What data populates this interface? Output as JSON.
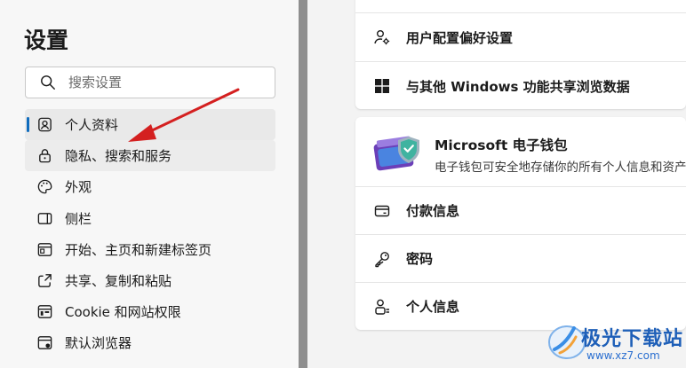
{
  "sidebar": {
    "title": "设置",
    "search": {
      "placeholder": "搜索设置"
    },
    "items": [
      {
        "label": "个人资料",
        "icon": "profile-icon"
      },
      {
        "label": "隐私、搜索和服务",
        "icon": "lock-icon"
      },
      {
        "label": "外观",
        "icon": "palette-icon"
      },
      {
        "label": "侧栏",
        "icon": "sidebar-icon"
      },
      {
        "label": "开始、主页和新建标签页",
        "icon": "home-icon"
      },
      {
        "label": "共享、复制和粘贴",
        "icon": "share-icon"
      },
      {
        "label": "Cookie 和网站权限",
        "icon": "site-permissions-icon"
      },
      {
        "label": "默认浏览器",
        "icon": "browser-icon"
      }
    ],
    "active_index": 0
  },
  "main": {
    "profile_card": {
      "rows": [
        {
          "label": "用户配置偏好设置",
          "icon": "user-settings-icon"
        },
        {
          "label": "与其他 Windows 功能共享浏览数据",
          "icon": "windows-icon"
        }
      ]
    },
    "wallet_card": {
      "title": "Microsoft 电子钱包",
      "description": "电子钱包可安全地存储你的所有个人信息和资产",
      "rows": [
        {
          "label": "付款信息",
          "icon": "card-icon"
        },
        {
          "label": "密码",
          "icon": "key-icon"
        },
        {
          "label": "个人信息",
          "icon": "person-info-icon"
        }
      ]
    }
  },
  "watermark": {
    "name": "极光下载站",
    "url": "www.xz7.com"
  },
  "colors": {
    "accent": "#0f6cbd",
    "annotation_arrow": "#d42020",
    "divider": "#8e8e8e"
  }
}
